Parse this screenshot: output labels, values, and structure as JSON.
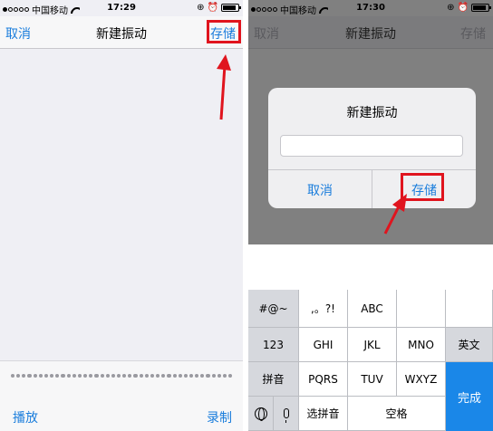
{
  "left": {
    "status": {
      "carrier": "中国移动",
      "time": "17:29"
    },
    "nav": {
      "cancel": "取消",
      "title": "新建振动",
      "save": "存储"
    },
    "bottom": {
      "play": "播放",
      "record": "录制"
    }
  },
  "right": {
    "status": {
      "carrier": "中国移动",
      "time": "17:30"
    },
    "nav": {
      "cancel": "取消",
      "title": "新建振动",
      "save": "存储"
    },
    "dialog": {
      "title": "新建振动",
      "name_value": "",
      "cancel": "取消",
      "save": "存储"
    },
    "keyboard": {
      "symbols": "#@~",
      "punct": ",。?!",
      "abc": "ABC",
      "numbers": "123",
      "ghi": "GHI",
      "jkl": "JKL",
      "mno": "MNO",
      "english": "英文",
      "pinyin": "拼音",
      "pqrs": "PQRS",
      "tuv": "TUV",
      "wxyz": "WXYZ",
      "done": "完成",
      "select_pinyin": "选拼音",
      "space": "空格"
    }
  },
  "icons": [
    "signal-dots-icon",
    "wifi-icon",
    "lock-rotation-icon",
    "alarm-icon",
    "battery-icon",
    "globe-icon",
    "microphone-icon",
    "red-arrow-icon"
  ],
  "colors": {
    "accent": "#1a7ddc",
    "highlight": "#e0141e",
    "done_key": "#1a87e8"
  }
}
